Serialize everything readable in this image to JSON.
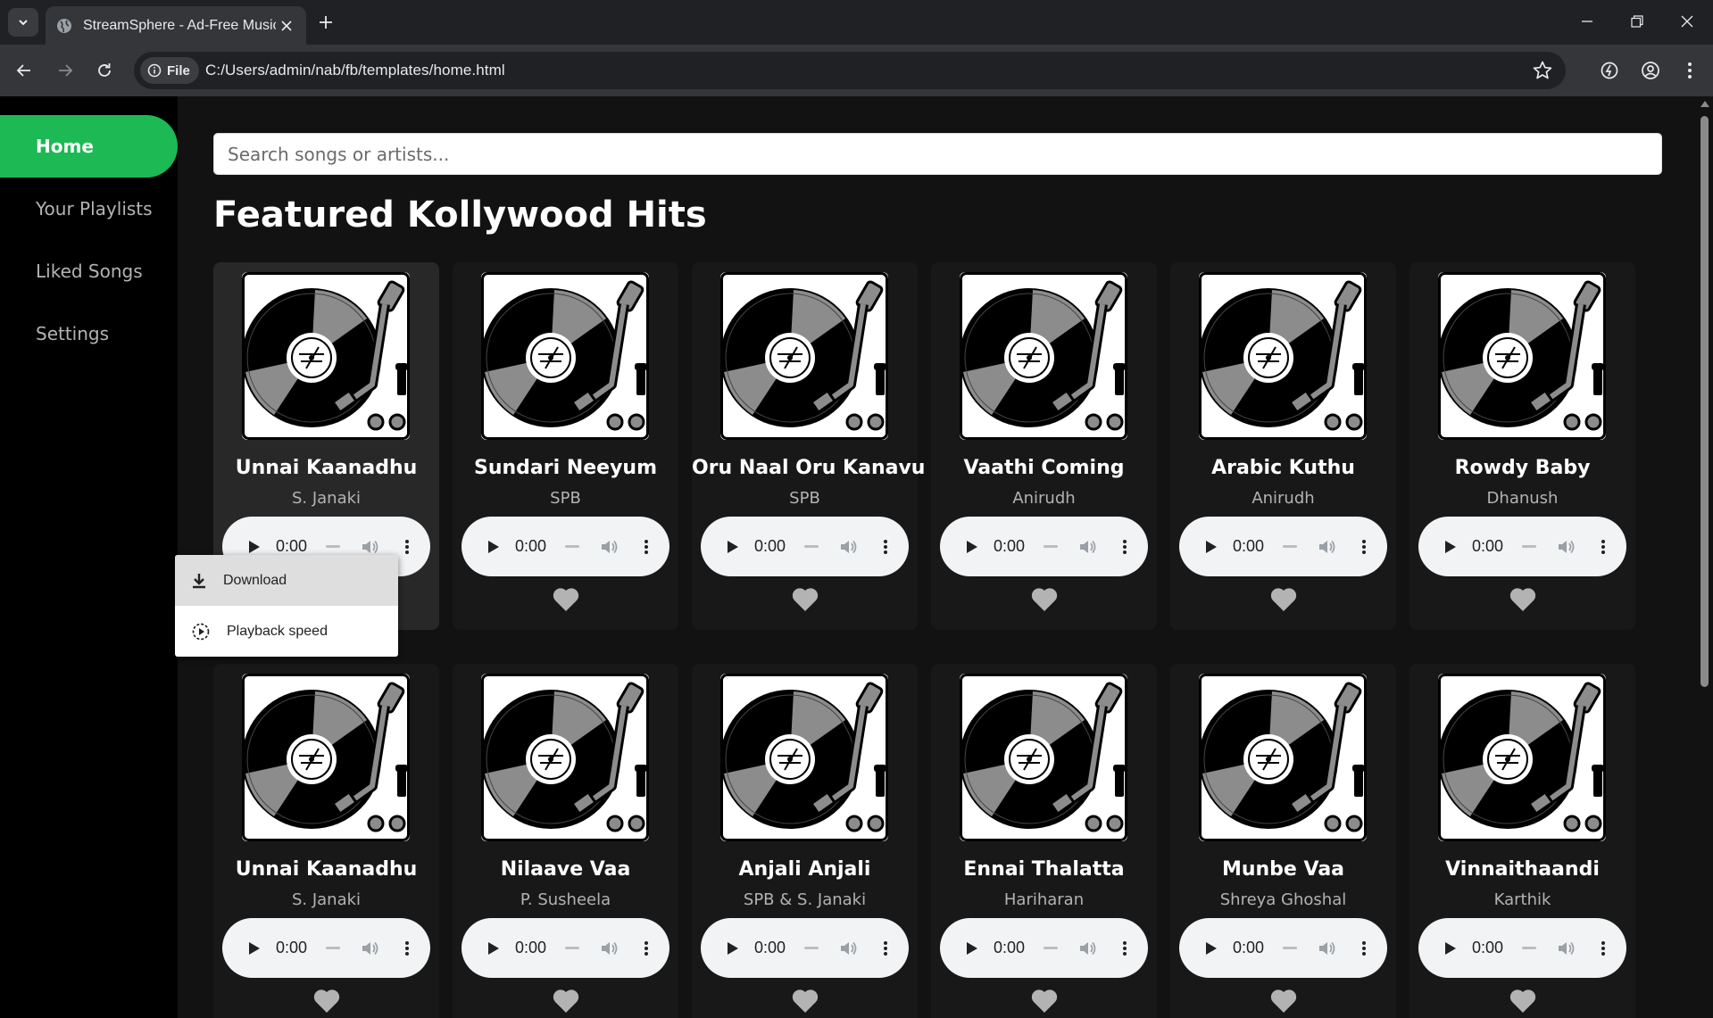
{
  "browser": {
    "tab_title": "StreamSphere - Ad-Free Music",
    "chip_label": "File",
    "url": "C:/Users/admin/nab/fb/templates/home.html"
  },
  "sidebar": {
    "items": [
      {
        "label": "Home",
        "active": true
      },
      {
        "label": "Your Playlists",
        "active": false
      },
      {
        "label": "Liked Songs",
        "active": false
      },
      {
        "label": "Settings",
        "active": false
      }
    ]
  },
  "search": {
    "placeholder": "Search songs or artists..."
  },
  "main": {
    "heading": "Featured Kollywood Hits"
  },
  "player_time": "0:00",
  "songs": [
    {
      "title": "Unnai Kaanadhu",
      "artist": "S. Janaki"
    },
    {
      "title": "Sundari Neeyum",
      "artist": "SPB"
    },
    {
      "title": "Oru Naal Oru Kanavu",
      "artist": "SPB"
    },
    {
      "title": "Vaathi Coming",
      "artist": "Anirudh"
    },
    {
      "title": "Arabic Kuthu",
      "artist": "Anirudh"
    },
    {
      "title": "Rowdy Baby",
      "artist": "Dhanush"
    },
    {
      "title": "Unnai Kaanadhu",
      "artist": "S. Janaki"
    },
    {
      "title": "Nilaave Vaa",
      "artist": "P. Susheela"
    },
    {
      "title": "Anjali Anjali",
      "artist": "SPB & S. Janaki"
    },
    {
      "title": "Ennai Thalatta",
      "artist": "Hariharan"
    },
    {
      "title": "Munbe Vaa",
      "artist": "Shreya Ghoshal"
    },
    {
      "title": "Vinnaithaandi",
      "artist": "Karthik"
    }
  ],
  "context_menu": {
    "items": [
      {
        "label": "Download",
        "icon": "download-icon"
      },
      {
        "label": "Playback speed",
        "icon": "playback-speed-icon"
      }
    ]
  },
  "colors": {
    "accent": "#1db954",
    "background": "#121212",
    "sidebar": "#000000",
    "card": "#181818"
  }
}
